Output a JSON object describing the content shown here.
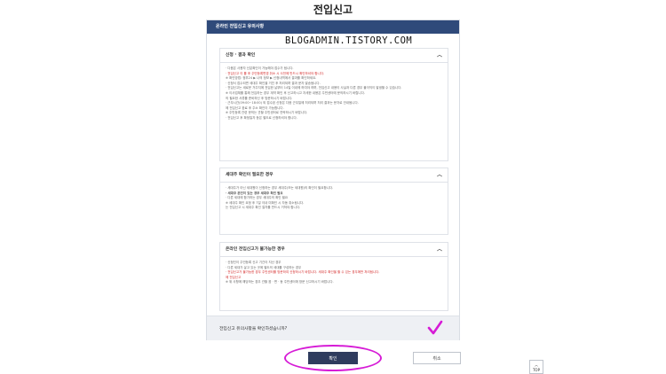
{
  "page": {
    "title": "전입신고"
  },
  "modal": {
    "header": "온라인 전입신고 유의사항",
    "watermark": "BLOGADMIN.TISTORY.COM",
    "sections": [
      {
        "title": "신청 · 결과 확인",
        "lines": [
          {
            "text": "· 다음은 사용자 신분확인이 가능해야 접수가 됩니다.",
            "style": "normal"
          },
          {
            "text": "· 전입신고 이 를 후 주민등록변경 취소 시 사전에 반드시 확인하셔야 합니다.",
            "style": "red"
          },
          {
            "text": "  ※ 확인방법: 정부24 ▶ 나의 정보 ▶ 신청내역에서 결과를 확인하세요.",
            "style": "normal"
          },
          {
            "text": "· 신청서 접수되면 세대주 확인을 거친 후 처리되며 결과 문자 발송됩니다.",
            "style": "normal"
          },
          {
            "text": "",
            "style": "normal"
          },
          {
            "text": "· 전입신고는 새로운 거주지에 전입한 날부터 14일 이내에 하여야 하며, 전입신고 내용이 사실과 다른 경우 불이익이 발생할 수 있습니다.",
            "style": "normal"
          },
          {
            "text": "  ※ 이사업체를 통해 전입하는 경우 계약 확인 후 신고하시고 자세한 내용은 주민센터에 문의하시기 바랍니다.",
            "style": "normal"
          },
          {
            "text": "  의 필요한 서류를 준비하신 후 방문하시기 바랍니다.",
            "style": "normal"
          },
          {
            "text": "· 근무시간(09:00~18:00) 외 접수된 신청은 다음 근무일에 처리되며 처리 결과는 문자로 안내됩니다.",
            "style": "normal"
          },
          {
            "text": "  에 전입신고 완료 후 주소 확인이 가능합니다.",
            "style": "normal"
          },
          {
            "text": "  ※ 주민등록 관련 문의는 관할 주민센터로 연락하시기 바랍니다.",
            "style": "normal"
          },
          {
            "text": "· 전입신고 후 확정일자 등은 별도로 신청하셔야 합니다.",
            "style": "normal"
          }
        ]
      },
      {
        "title": "세대주 확인이 필요한 경우",
        "lines": [
          {
            "text": "· 세대주가 아닌 세대원이 신청하는 경우 세대주(또는 세대원)의 확인이 필요합니다.",
            "style": "normal"
          },
          {
            "text": "· 세대주 본인이 있는 경우 세대주 확인 필요",
            "style": "bold"
          },
          {
            "text": "· 다른 세대에 합가하는 경우 세대주의 확인 필요",
            "style": "normal"
          },
          {
            "text": "  ※ 세대주 확인 요청 후 7일 이내 미확인 시 자동 취소됩니다.",
            "style": "normal"
          },
          {
            "text": "  는 전입신고 시 세대주 확인 절차를 반드시 거쳐야 합니다.",
            "style": "normal"
          }
        ]
      },
      {
        "title": "온라인 전입신고가 불가능한 경우",
        "lines": [
          {
            "text": "· 신청인이 주민등록 신고 기간이 지난 경우",
            "style": "normal"
          },
          {
            "text": "· 다른 세대가 살고 있는 곳에 별도의 세대를 구성하는 경우",
            "style": "normal"
          },
          {
            "text": "",
            "style": "normal"
          },
          {
            "text": "· 전입신고가 불가능한 경우 주민센터를 방문하여 신청하시기 바랍니다. 세대주 확인을 할 수 있는 경우에만 처리됩니다.",
            "style": "red"
          },
          {
            "text": "  에 전입신고",
            "style": "red"
          },
          {
            "text": "",
            "style": "normal"
          },
          {
            "text": "  ※ 위 사항에 해당하는 경우 관할 읍 · 면 · 동 주민센터에 방문 신고하시기 바랍니다.",
            "style": "normal"
          }
        ]
      }
    ],
    "confirm_text": "전입신고 유의사항을 확인하셨습니까?"
  },
  "buttons": {
    "confirm": "확인",
    "cancel": "취소",
    "top": "TOP"
  },
  "colors": {
    "header": "#2f4a7a",
    "confirm_button": "#2f3c5e",
    "highlight": "#d61bd6",
    "warning": "#d42a2a"
  }
}
